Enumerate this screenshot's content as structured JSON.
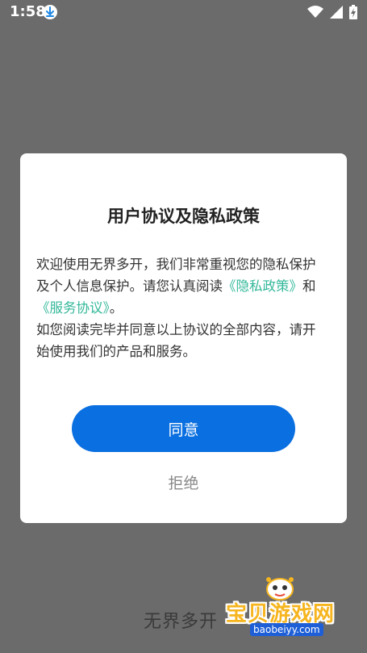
{
  "status_bar": {
    "time": "1:58"
  },
  "background": {
    "app_name": "无界多开"
  },
  "dialog": {
    "title": "用户协议及隐私政策",
    "paragraph1_before": "欢迎使用无界多开，我们非常重视您的隐私保护及个人信息保护。请您认真阅读",
    "privacy_link": "《隐私政策》",
    "paragraph1_middle": "和",
    "terms_link": "《服务协议》",
    "paragraph1_after": "。",
    "paragraph2": "如您阅读完毕并同意以上协议的全部内容，请开始使用我们的产品和服务。",
    "agree_label": "同意",
    "reject_label": "拒绝"
  },
  "watermark": {
    "name": "宝贝游戏网",
    "domain": "baobeiyy.com"
  },
  "colors": {
    "overlay": "#6b6b6b",
    "primary": "#0a6fe0",
    "link": "#33b89a"
  }
}
